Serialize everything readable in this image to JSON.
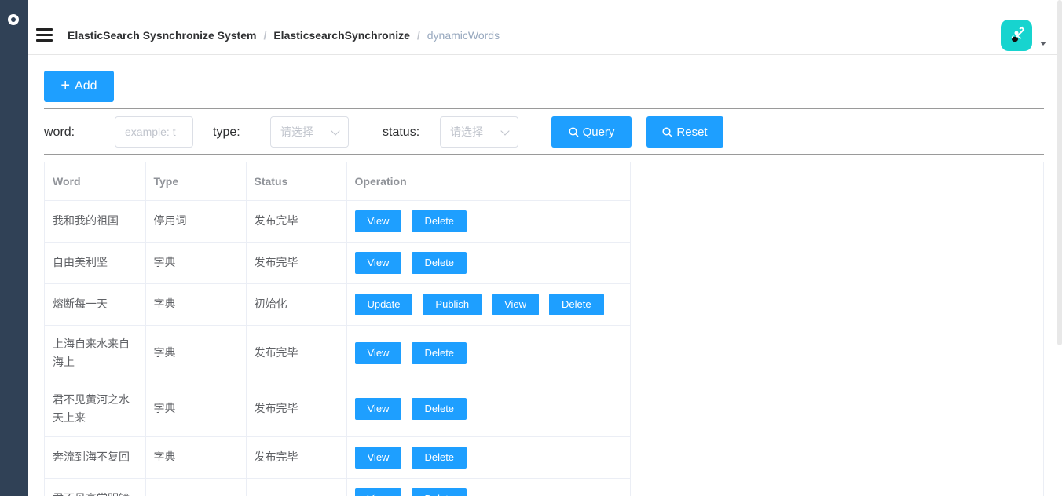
{
  "header": {
    "breadcrumb": [
      "ElasticSearch Sysnchronize System",
      "ElasticsearchSynchronize",
      "dynamicWords"
    ],
    "separator": "/"
  },
  "toolbar": {
    "add_label": "Add"
  },
  "filters": {
    "word_label": "word:",
    "word_placeholder": "example: t",
    "type_label": "type:",
    "type_placeholder": "请选择",
    "status_label": "status:",
    "status_placeholder": "请选择",
    "query_label": "Query",
    "reset_label": "Reset"
  },
  "table": {
    "columns": [
      "Word",
      "Type",
      "Status",
      "Operation"
    ],
    "rows": [
      {
        "word": "我和我的祖国",
        "type": "停用词",
        "status": "发布完毕",
        "ops": [
          "View",
          "Delete"
        ]
      },
      {
        "word": "自由美利坚",
        "type": "字典",
        "status": "发布完毕",
        "ops": [
          "View",
          "Delete"
        ]
      },
      {
        "word": "熔断每一天",
        "type": "字典",
        "status": "初始化",
        "ops": [
          "Update",
          "Publish",
          "View",
          "Delete"
        ]
      },
      {
        "word": "上海自来水来自海上",
        "type": "字典",
        "status": "发布完毕",
        "ops": [
          "View",
          "Delete"
        ]
      },
      {
        "word": "君不见黄河之水天上来",
        "type": "字典",
        "status": "发布完毕",
        "ops": [
          "View",
          "Delete"
        ]
      },
      {
        "word": "奔流到海不复回",
        "type": "字典",
        "status": "发布完毕",
        "ops": [
          "View",
          "Delete"
        ]
      },
      {
        "word": "君不见高堂明镜",
        "type": "",
        "status": "",
        "ops": [
          "View",
          "Delete"
        ]
      }
    ]
  },
  "colors": {
    "primary": "#1e9fff",
    "sidebar": "#304156",
    "avatar": "#17d4cf"
  }
}
